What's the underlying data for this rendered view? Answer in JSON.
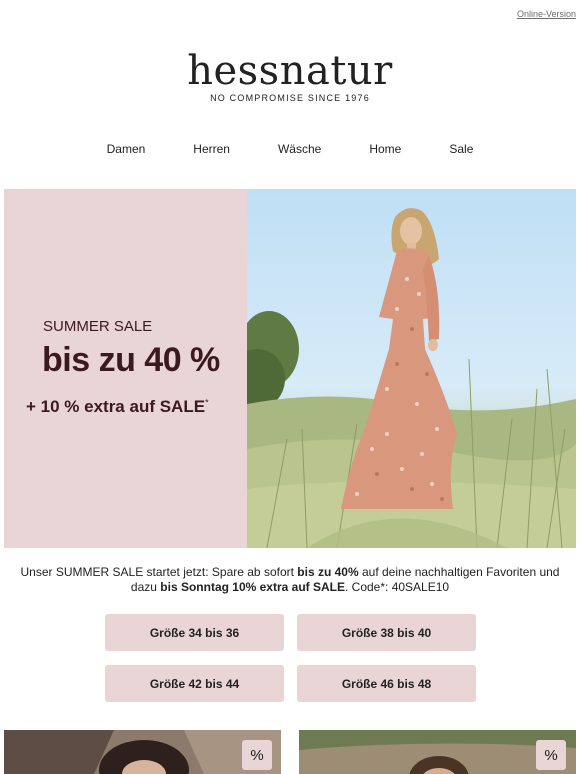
{
  "header": {
    "online_version": "Online-Version",
    "brand": "hessnatur",
    "tagline": "NO COMPROMISE SINCE 1976"
  },
  "nav": {
    "items": [
      {
        "label": "Damen"
      },
      {
        "label": "Herren"
      },
      {
        "label": "Wäsche"
      },
      {
        "label": "Home"
      },
      {
        "label": "Sale"
      }
    ]
  },
  "hero": {
    "eyebrow": "SUMMER SALE",
    "headline": "bis zu 40 %",
    "extra": "+ 10 % extra auf SALE",
    "extra_mark": "*",
    "image_label": "woman-in-floral-dress-meadow"
  },
  "intro": {
    "part1": "Unser SUMMER SALE startet jetzt: Spare ab sofort ",
    "bold1": "bis zu 40%",
    "part2": " auf deine nachhaltigen Favoriten und dazu ",
    "bold2": "bis Sonntag 10% extra auf SALE",
    "part3": ". Code*: 40SALE10"
  },
  "sizes": [
    {
      "label": "Größe 34 bis 36"
    },
    {
      "label": "Größe 38 bis 40"
    },
    {
      "label": "Größe 42 bis 44"
    },
    {
      "label": "Größe 46 bis 48"
    }
  ],
  "products": [
    {
      "badge": "%"
    },
    {
      "badge": "%"
    }
  ],
  "colors": {
    "pink": "#ead5d6",
    "burgundy": "#3b1a1d"
  }
}
